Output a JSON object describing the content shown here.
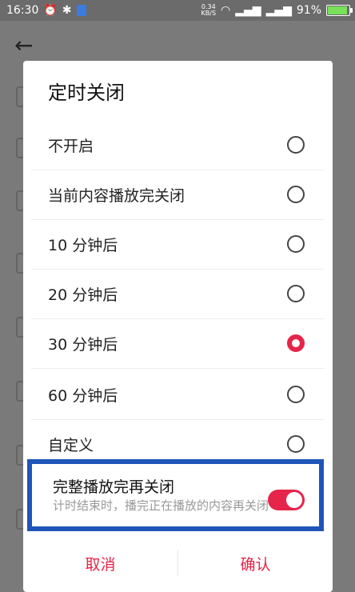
{
  "status_bar": {
    "time": "16:30",
    "speed_value": "0.34",
    "speed_unit": "KB/S",
    "battery": "91%",
    "icons": [
      "alarm-icon",
      "bluetooth-icon",
      "shield-icon",
      "signal-4g-icon",
      "signal-3g-icon",
      "wifi-icon",
      "battery-icon"
    ]
  },
  "dialog": {
    "title": "定时关闭",
    "options": [
      {
        "label": "不开启",
        "selected": false
      },
      {
        "label": "当前内容播放完关闭",
        "selected": false
      },
      {
        "label": "10 分钟后",
        "selected": false
      },
      {
        "label": "20 分钟后",
        "selected": false
      },
      {
        "label": "30 分钟后",
        "selected": true
      },
      {
        "label": "60 分钟后",
        "selected": false
      },
      {
        "label": "自定义",
        "selected": false
      }
    ],
    "complete_close": {
      "title": "完整播放完再关闭",
      "description": "计时结束时，播完正在播放的内容再关闭",
      "enabled": true
    },
    "cancel_label": "取消",
    "confirm_label": "确认"
  },
  "colors": {
    "accent": "#e5254a",
    "highlight_border": "#1e55b8"
  }
}
